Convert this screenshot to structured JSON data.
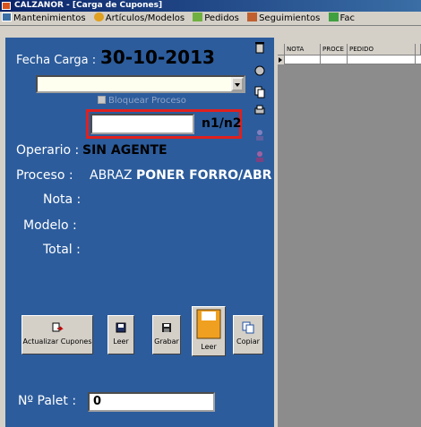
{
  "window": {
    "title": "CALZANOR - [Carga de Cupones]"
  },
  "menu": [
    {
      "label": "Mantenimientos",
      "icon": "window-icon"
    },
    {
      "label": "Artículos/Modelos",
      "icon": "shoe-icon"
    },
    {
      "label": "Pedidos",
      "icon": "cart-icon"
    },
    {
      "label": "Seguimientos",
      "icon": "chart-icon"
    },
    {
      "label": "Fac",
      "icon": "invoice-icon"
    }
  ],
  "form": {
    "fecha_label": "Fecha Carga :",
    "fecha_value": "30-10-2013",
    "combo_value": "",
    "bloquear_label": "Bloquear Proceso",
    "n_input_value": "",
    "n_label": "n1/n2",
    "operario_label": "Operario :",
    "operario_value": "SIN AGENTE",
    "proceso_label": "Proceso :",
    "proceso_code": "ABRAZ",
    "proceso_name": "PONER FORRO/ABR",
    "nota_label": "Nota :",
    "modelo_label": "Modelo :",
    "total_label": "Total :",
    "palet_label": "Nº Palet :",
    "palet_value": "0"
  },
  "buttons": {
    "actualizar": "Actualizar Cupones",
    "leer1": "Leer",
    "grabar": "Grabar",
    "leer2": "Leer",
    "copiar": "Copiar"
  },
  "grid": {
    "columns": [
      "NOTA",
      "PROCE",
      "PEDIDO",
      ""
    ]
  },
  "colors": {
    "panel": "#2c5c9c",
    "highlight_frame": "#e0201e"
  }
}
